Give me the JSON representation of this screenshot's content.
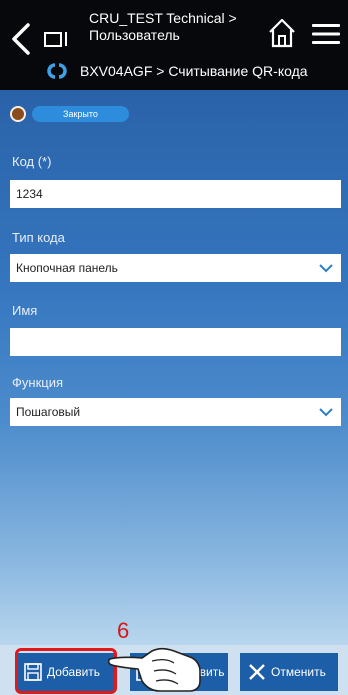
{
  "header": {
    "title_line1": "CRU_TEST Technical >",
    "title_line2": "Пользователь",
    "device_line": "BXV04AGF > Считывание QR-кода",
    "icons": [
      "back-icon",
      "tabs-icon",
      "home-icon",
      "menu-icon",
      "sync-icon"
    ]
  },
  "status": {
    "badge": "Закрыто",
    "dot_color": "#8a4b1d"
  },
  "form": {
    "code_label": "Код (*)",
    "code_value": "1234",
    "code_type_label": "Тип кода",
    "code_type_value": "Кнопочная панель",
    "name_label": "Имя",
    "name_value": "",
    "function_label": "Функция",
    "function_value": "Пошаговый"
  },
  "footer": {
    "add_label": "Добавить",
    "save_label": "авить",
    "cancel_label": "Отменить"
  },
  "annotation": {
    "step_number": "6"
  },
  "colors": {
    "header_bg": "#06080c",
    "accent_blue": "#1d5ea8",
    "highlight_red": "#e01a1a"
  }
}
